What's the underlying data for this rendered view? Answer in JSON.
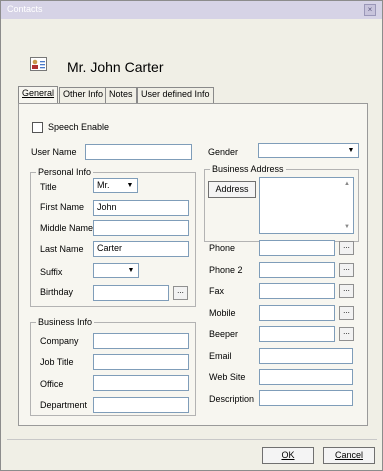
{
  "window": {
    "title": "Contacts",
    "close_symbol": "×"
  },
  "header": {
    "contact_name": "Mr. John Carter",
    "icon": "contact-card-icon"
  },
  "tabs": [
    {
      "label": "General",
      "active": true
    },
    {
      "label": "Other Info",
      "active": false
    },
    {
      "label": "Notes",
      "active": false
    },
    {
      "label": "User defined Info",
      "active": false
    }
  ],
  "general": {
    "speech_enable_label": "Speech Enable",
    "speech_enable_checked": false,
    "user_name_label": "User Name",
    "user_name_value": "",
    "gender_label": "Gender",
    "gender_value": "",
    "personal_info": {
      "title": "Personal Info",
      "title_label": "Title",
      "title_value": "Mr.",
      "first_name_label": "First Name",
      "first_name_value": "John",
      "middle_name_label": "Middle Name",
      "middle_name_value": "",
      "last_name_label": "Last Name",
      "last_name_value": "Carter",
      "suffix_label": "Suffix",
      "suffix_value": "",
      "birthday_label": "Birthday",
      "birthday_value": "",
      "birthday_button": "..."
    },
    "business_info": {
      "title": "Business Info",
      "company_label": "Company",
      "company_value": "",
      "job_title_label": "Job Title",
      "job_title_value": "",
      "office_label": "Office",
      "office_value": "",
      "department_label": "Department",
      "department_value": ""
    },
    "business_address": {
      "title": "Business Address",
      "address_button": "Address",
      "address_value": "",
      "phone_label": "Phone",
      "phone2_label": "Phone 2",
      "fax_label": "Fax",
      "mobile_label": "Mobile",
      "beeper_label": "Beeper",
      "email_label": "Email",
      "website_label": "Web Site",
      "description_label": "Description",
      "ellipsis": "..."
    }
  },
  "footer": {
    "ok_label": "OK",
    "cancel_label": "Cancel"
  }
}
